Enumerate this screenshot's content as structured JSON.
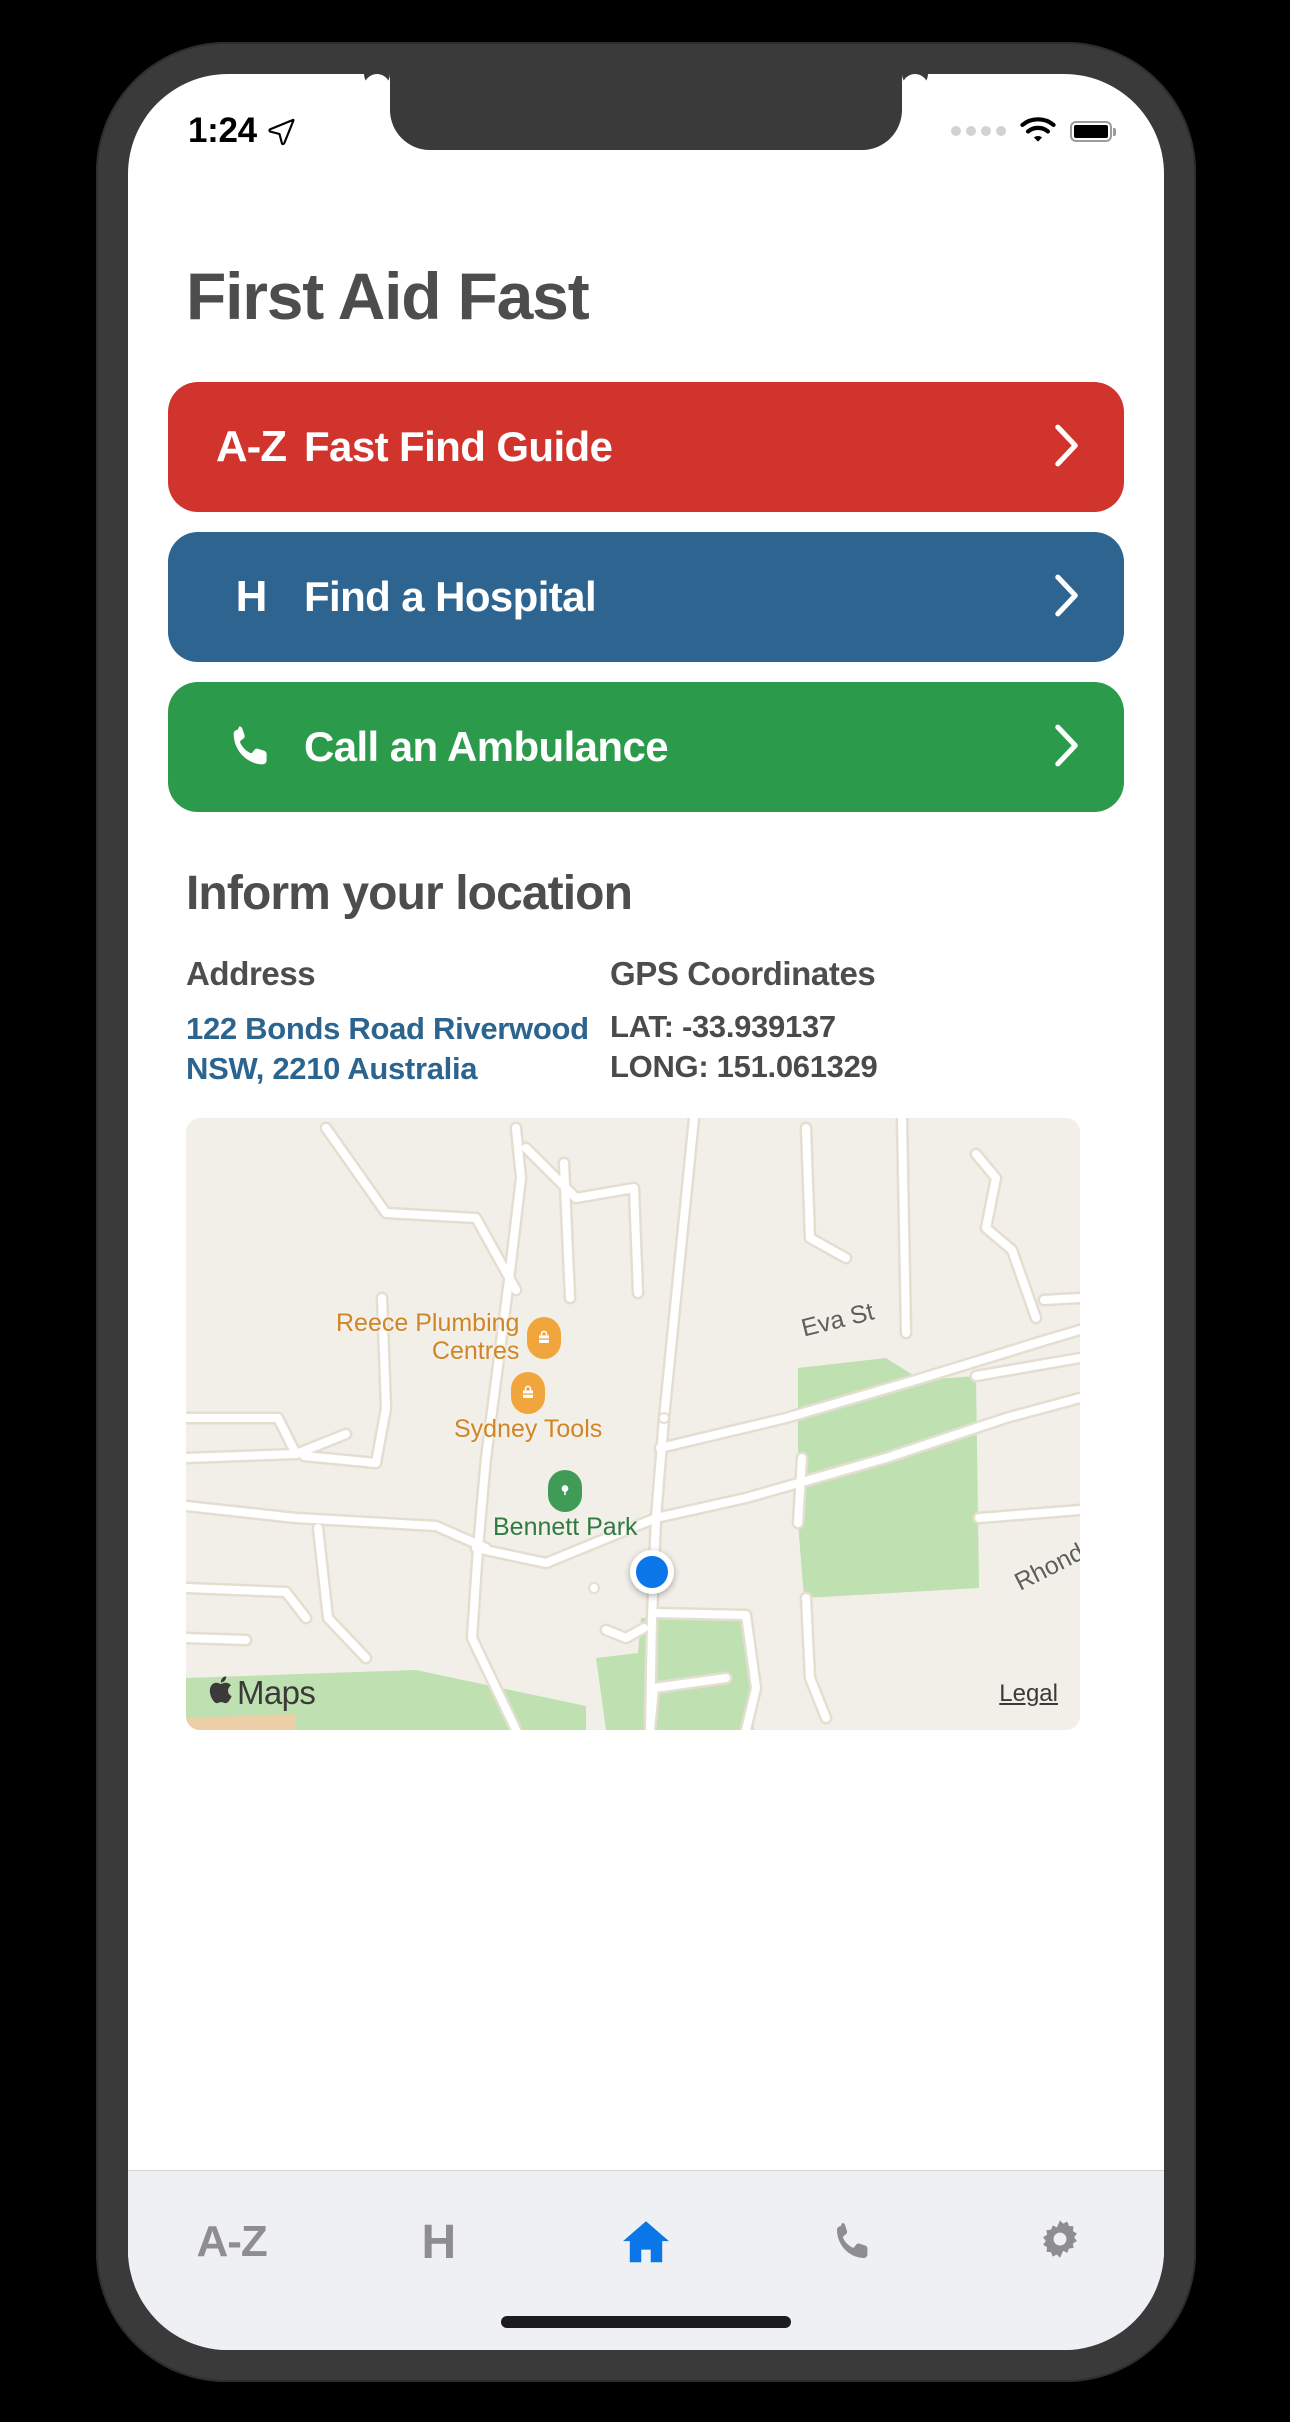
{
  "status_bar": {
    "time": "1:24",
    "location_arrow_icon": "location-arrow-icon",
    "signal_icon": "signal-dots-icon",
    "wifi_icon": "wifi-icon",
    "battery_icon": "battery-full-icon"
  },
  "header": {
    "title": "First Aid Fast"
  },
  "actions": [
    {
      "lead_text": "A-Z",
      "lead_icon": "az-text-icon",
      "label": "Fast Find Guide",
      "color": "#d0342c",
      "chevron_icon": "chevron-right-icon",
      "name": "fast-find-guide-button"
    },
    {
      "lead_text": "H",
      "lead_icon": "hospital-h-icon",
      "label": "Find a Hospital",
      "color": "#2e6490",
      "chevron_icon": "chevron-right-icon",
      "name": "find-a-hospital-button"
    },
    {
      "lead_text": "",
      "lead_icon": "phone-icon",
      "label": "Call an Ambulance",
      "color": "#2b9a4b",
      "chevron_icon": "chevron-right-icon",
      "name": "call-an-ambulance-button"
    }
  ],
  "location_section": {
    "title": "Inform your location",
    "address_heading": "Address",
    "address_line_1": "122 Bonds Road Riverwood",
    "address_line_2": "NSW, 2210 Australia",
    "gps_heading": "GPS Coordinates",
    "lat_line": "LAT: -33.939137",
    "long_line": "LONG: 151.061329",
    "address_color": "#2c6490"
  },
  "map": {
    "pois": [
      {
        "label_line_1": "Reece Plumbing",
        "label_line_2": "Centres",
        "kind": "shop"
      },
      {
        "label_line_1": "Sydney Tools",
        "label_line_2": "",
        "kind": "shop"
      },
      {
        "label_line_1": "Bennett Park",
        "label_line_2": "",
        "kind": "park"
      }
    ],
    "streets": [
      "Eva St",
      "Rhonda"
    ],
    "attribution": "Maps",
    "apple_logo_icon": "apple-logo-icon",
    "legal_link": "Legal",
    "user_location_icon": "user-location-dot-icon",
    "land_color": "#f2efe9",
    "road_color": "#ffffff",
    "park_color": "#bfe0b0"
  },
  "tabbar": {
    "items": [
      {
        "label": "A-Z",
        "icon": "az-text-icon",
        "name": "tab-a-z",
        "active": false
      },
      {
        "label": "H",
        "icon": "hospital-h-icon",
        "name": "tab-hospital",
        "active": false
      },
      {
        "label": "",
        "icon": "home-icon",
        "name": "tab-home",
        "active": true
      },
      {
        "label": "",
        "icon": "phone-icon",
        "name": "tab-call",
        "active": false
      },
      {
        "label": "",
        "icon": "gear-icon",
        "name": "tab-settings",
        "active": false
      }
    ],
    "active_color": "#0a76e8",
    "inactive_color": "#8e8e92",
    "background": "#eff0f4"
  }
}
